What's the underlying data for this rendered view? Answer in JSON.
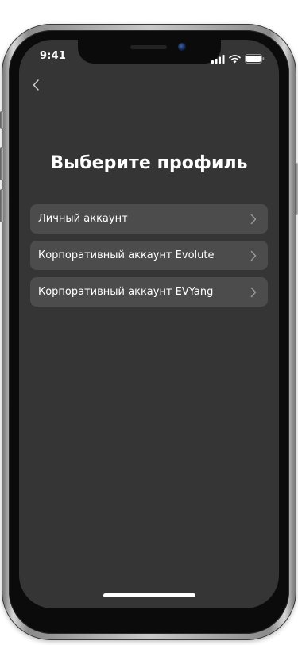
{
  "status_bar": {
    "time": "9:41",
    "icons": [
      "signal-icon",
      "wifi-icon",
      "battery-icon"
    ]
  },
  "header": {
    "back_icon": "chevron-left-icon",
    "title": "Выберите профиль"
  },
  "profiles": [
    {
      "label": "Личный аккаунт",
      "icon": "chevron-right-icon"
    },
    {
      "label": "Корпоративный аккаунт Evolute",
      "icon": "chevron-right-icon"
    },
    {
      "label": "Корпоративный аккаунт EVYang",
      "icon": "chevron-right-icon"
    }
  ],
  "colors": {
    "screen_background": "#353535",
    "item_background": "#4c4c4c",
    "text": "#ffffff",
    "chevron": "#9a9a9a"
  }
}
